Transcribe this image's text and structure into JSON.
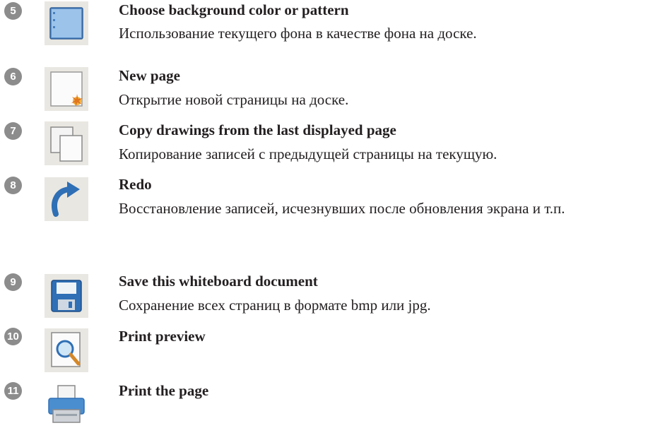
{
  "items": [
    {
      "number": "5",
      "icon": "background-color-icon",
      "title": "Choose background color or pattern",
      "description": "Использование текущего фона в качестве фона на доске."
    },
    {
      "number": "6",
      "icon": "new-page-icon",
      "title": "New page",
      "description": "Открытие новой страницы на доске."
    },
    {
      "number": "7",
      "icon": "copy-pages-icon",
      "title": "Copy drawings from the last displayed page",
      "description": "Копирование записей с предыдущей страницы на текущую."
    },
    {
      "number": "8",
      "icon": "redo-icon",
      "title": "Redo",
      "description": "Восстановление записей, исчезнувших после обновления экрана и т.п."
    },
    {
      "number": "9",
      "icon": "save-icon",
      "title": "Save this whiteboard document",
      "description": "Сохранение всех страниц в формате bmp или jpg."
    },
    {
      "number": "10",
      "icon": "print-preview-icon",
      "title": "Print preview",
      "description": ""
    },
    {
      "number": "11",
      "icon": "printer-icon",
      "title": "Print the page",
      "description": ""
    }
  ]
}
